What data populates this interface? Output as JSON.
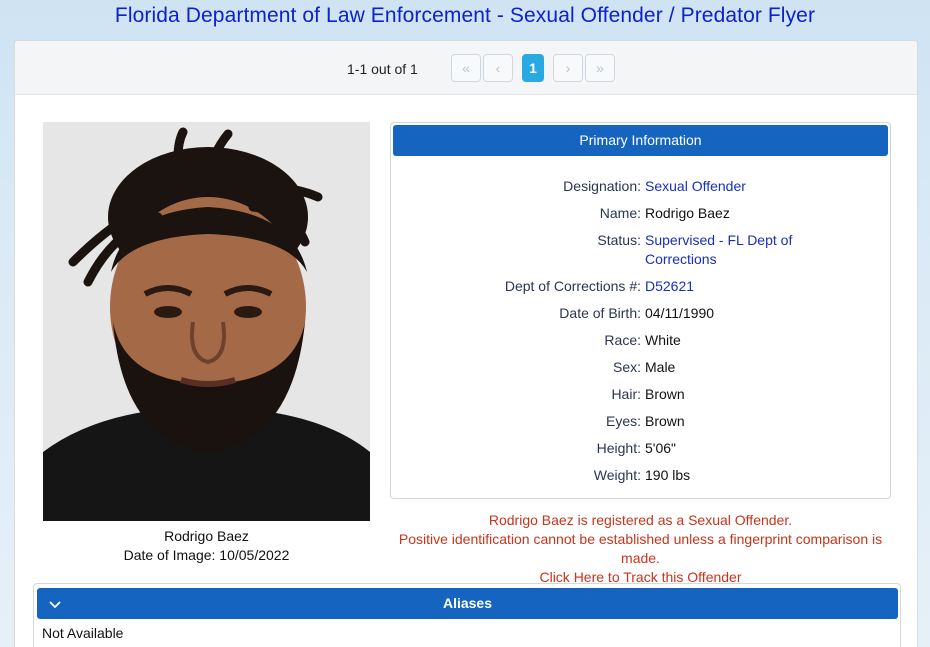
{
  "page": {
    "title": "Florida Department of Law Enforcement - Sexual Offender / Predator Flyer"
  },
  "pager": {
    "count_text": "1-1 out of 1",
    "first_icon": "«",
    "prev_icon": "‹",
    "current_page": "1",
    "next_icon": "›",
    "last_icon": "»"
  },
  "photo": {
    "name": "Rodrigo Baez",
    "date_of_image": "Date of Image: 10/05/2022"
  },
  "primary_info": {
    "header": "Primary Information",
    "rows": [
      {
        "label": "Designation:",
        "value": "Sexual Offender",
        "link": true
      },
      {
        "label": "Name:",
        "value": "Rodrigo Baez",
        "link": false
      },
      {
        "label": "Status:",
        "value": "Supervised - FL Dept of Corrections",
        "link": true
      },
      {
        "label": "Dept of Corrections #:",
        "value": "D52621",
        "link": true
      },
      {
        "label": "Date of Birth:",
        "value": "04/11/1990",
        "link": false
      },
      {
        "label": "Race:",
        "value": "White",
        "link": false
      },
      {
        "label": "Sex:",
        "value": "Male",
        "link": false
      },
      {
        "label": "Hair:",
        "value": "Brown",
        "link": false
      },
      {
        "label": "Eyes:",
        "value": "Brown",
        "link": false
      },
      {
        "label": "Height:",
        "value": "5'06\"",
        "link": false
      },
      {
        "label": "Weight:",
        "value": "190 lbs",
        "link": false
      }
    ]
  },
  "warning": {
    "line1": "Rodrigo Baez is registered as a Sexual Offender.",
    "line2": "Positive identification cannot be established unless a fingerprint comparison is made.",
    "track_link": "Click Here to Track this Offender"
  },
  "aliases": {
    "chevron_icon": "chevron-down-icon",
    "header": "Aliases",
    "value": "Not Available"
  },
  "colors": {
    "title_blue": "#0d22c9",
    "header_blue": "#1565c0",
    "active_page": "#29a9e1",
    "warning_red": "#c8341c",
    "link_blue": "#1a2fb8"
  }
}
